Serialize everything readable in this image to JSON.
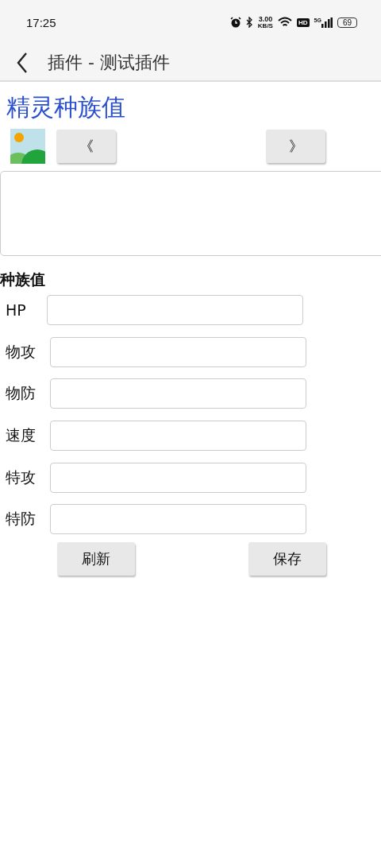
{
  "status_bar": {
    "time": "17:25",
    "speed": "3.00",
    "speed_unit": "KB/S",
    "hd": "HD",
    "network": "5G",
    "battery": "69"
  },
  "app_bar": {
    "title": "插件 - 测试插件"
  },
  "heading": "精灵种族值",
  "nav_buttons": [
    "《",
    "》"
  ],
  "section_label": "种族值",
  "fields": [
    {
      "label": "HP"
    },
    {
      "label": "物攻"
    },
    {
      "label": "物防"
    },
    {
      "label": "速度"
    },
    {
      "label": "特攻"
    },
    {
      "label": "特防"
    }
  ],
  "buttons": [
    "刷新",
    "保存"
  ]
}
